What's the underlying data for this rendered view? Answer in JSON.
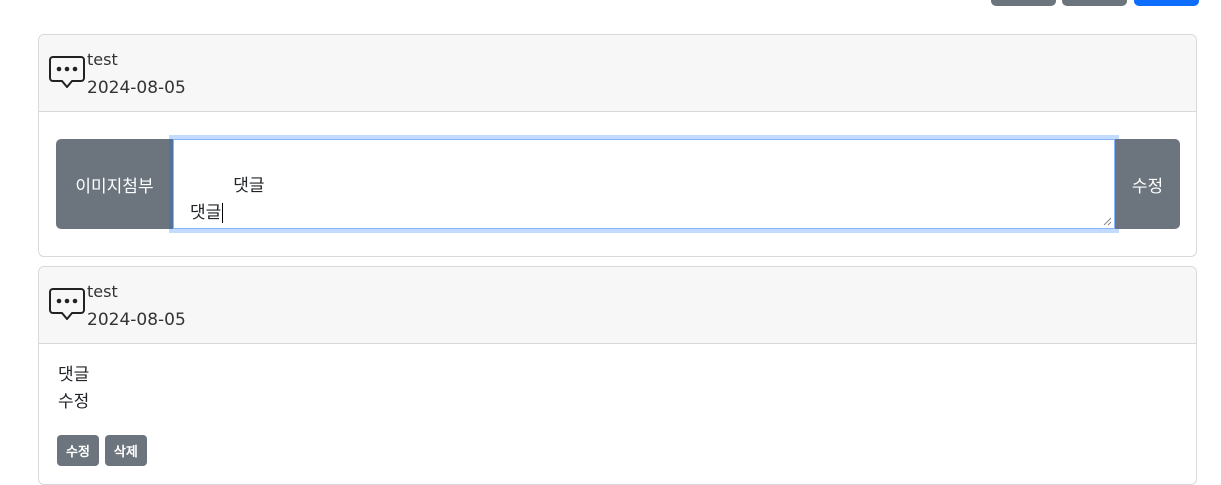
{
  "colors": {
    "secondary": "#6c757d",
    "primary": "#0d6efd",
    "focus_border": "#86b7fe"
  },
  "comments": [
    {
      "icon": "chat-dots-icon",
      "author": "test",
      "date": "2024-08-05",
      "mode": "editing",
      "attach_label": "이미지첨부",
      "textarea_value": "댓글\n댓글",
      "submit_label": "수정"
    },
    {
      "icon": "chat-dots-icon",
      "author": "test",
      "date": "2024-08-05",
      "mode": "view",
      "content": "댓글\n수정",
      "edit_label": "수정",
      "delete_label": "삭제"
    }
  ]
}
